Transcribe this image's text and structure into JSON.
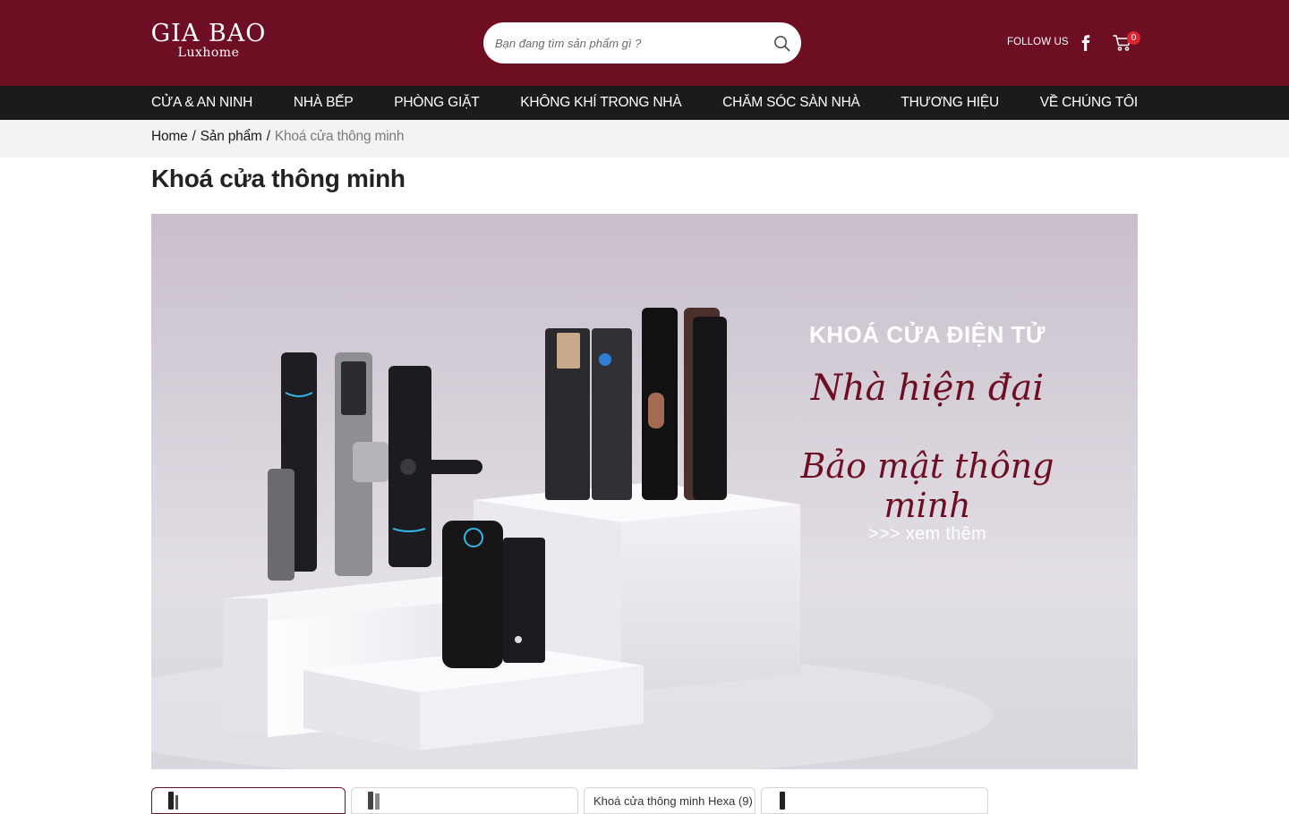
{
  "header": {
    "logo_main": "GIA BAO",
    "logo_sub": "Luxhome",
    "search_placeholder": "Bạn đang tìm sản phẩm gì ?",
    "follow_label": "FOLLOW US",
    "cart_count": "0"
  },
  "nav": {
    "items": [
      {
        "label": "CỬA & AN NINH"
      },
      {
        "label": "NHÀ BẾP"
      },
      {
        "label": "PHÒNG GIẶT"
      },
      {
        "label": "KHÔNG KHÍ TRONG NHÀ"
      },
      {
        "label": "CHĂM SÓC SÀN NHÀ"
      },
      {
        "label": "THƯƠNG HIỆU"
      },
      {
        "label": "VỀ CHÚNG TÔI"
      }
    ]
  },
  "breadcrumb": {
    "home": "Home",
    "products": "Sản phẩm",
    "current": "Khoá cửa thông minh",
    "separator": "/"
  },
  "page": {
    "title": "Khoá cửa thông minh"
  },
  "banner": {
    "headline": "KHOÁ CỬA ĐIỆN TỬ",
    "script_line1": "Nhà hiện đại",
    "script_line2": "Bảo mật thông minh",
    "more_link": ">>> xem thêm"
  },
  "tabs": [
    {
      "label": "",
      "has_thumb": true,
      "active": true
    },
    {
      "label": "",
      "has_thumb": true,
      "active": false
    },
    {
      "label": "Khoá cửa thông minh Hexa (9)",
      "has_thumb": false,
      "active": false
    },
    {
      "label": "",
      "has_thumb": true,
      "active": false
    }
  ],
  "colors": {
    "brand": "#6e0e22",
    "nav_bg": "#1b1b1b",
    "crumb_bg": "#f4f3f1",
    "badge": "#e0242f"
  }
}
